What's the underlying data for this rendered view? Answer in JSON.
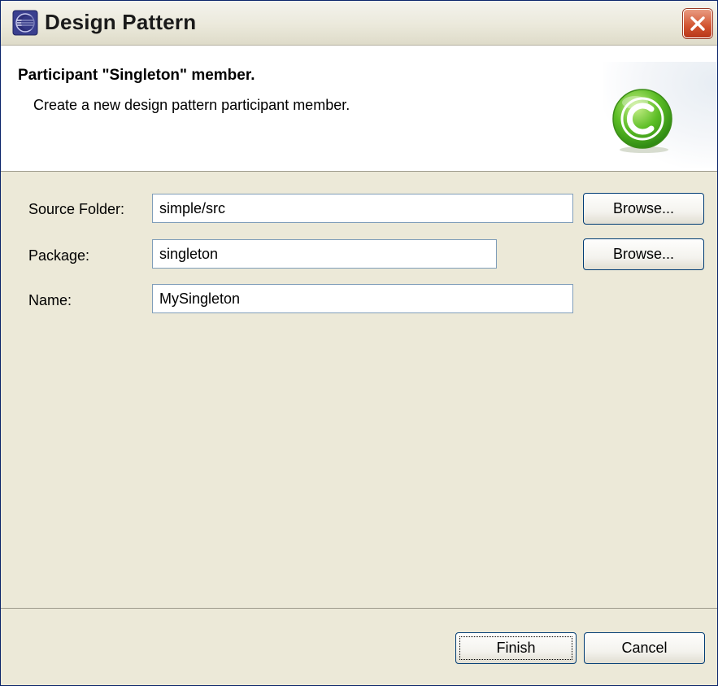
{
  "window": {
    "title": "Design Pattern",
    "app_icon": "eclipse-icon",
    "close_icon": "close-icon"
  },
  "banner": {
    "title": "Participant \"Singleton\" member.",
    "description": "Create a new design pattern participant member.",
    "icon": "class-c-icon"
  },
  "form": {
    "source_folder": {
      "label": "Source Folder:",
      "value": "simple/src",
      "browse_label": "Browse..."
    },
    "package": {
      "label": "Package:",
      "value": "singleton",
      "browse_label": "Browse..."
    },
    "name": {
      "label": "Name:",
      "value": "MySingleton"
    }
  },
  "buttons": {
    "finish": "Finish",
    "cancel": "Cancel"
  },
  "colors": {
    "window_bg": "#ece9d8",
    "banner_bg": "#ffffff",
    "close_button": "#d2532f",
    "c_icon_green": "#4fb221",
    "field_border": "#7f9db9"
  }
}
